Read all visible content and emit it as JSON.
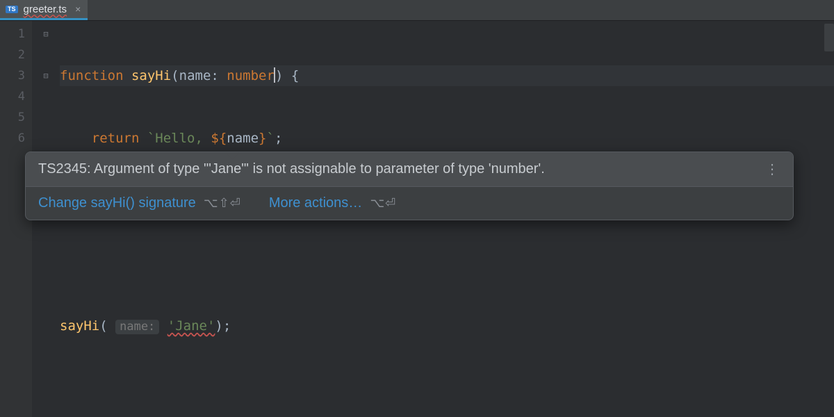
{
  "tab": {
    "filetype_badge": "TS",
    "filename": "greeter.ts",
    "close_glyph": "×"
  },
  "gutter_lines": [
    "1",
    "2",
    "3",
    "4",
    "5",
    "6"
  ],
  "fold_glyphs": {
    "open": "⊟",
    "close": "⊟"
  },
  "code": {
    "l1_kw_function": "function",
    "l1_fn_name": "sayHi",
    "l1_paren_open": "(",
    "l1_param_name": "name",
    "l1_colon": ":",
    "l1_param_type": "number",
    "l1_paren_close": ")",
    "l1_brace_open": "{",
    "l2_kw_return": "return",
    "l2_str_open": "`Hello, ",
    "l2_interp_open": "${",
    "l2_interp_var": "name",
    "l2_interp_close": "}",
    "l2_str_close": "`",
    "l2_semi": ";",
    "l3_brace_close": "}",
    "l5_call_fn": "sayHi",
    "l5_paren_open": "(",
    "l5_inlay_hint": "name:",
    "l5_arg_value": "'Jane'",
    "l5_paren_close": ")",
    "l5_semi": ";"
  },
  "tooltip": {
    "message": "TS2345: Argument of type '\"Jane\"' is not assignable to parameter of type 'number'.",
    "kebab_glyph": "⋮",
    "action_fix_signature": "Change sayHi() signature",
    "action_fix_shortcut": "⌥⇧⏎",
    "action_more": "More actions…",
    "action_more_shortcut": "⌥⏎"
  }
}
